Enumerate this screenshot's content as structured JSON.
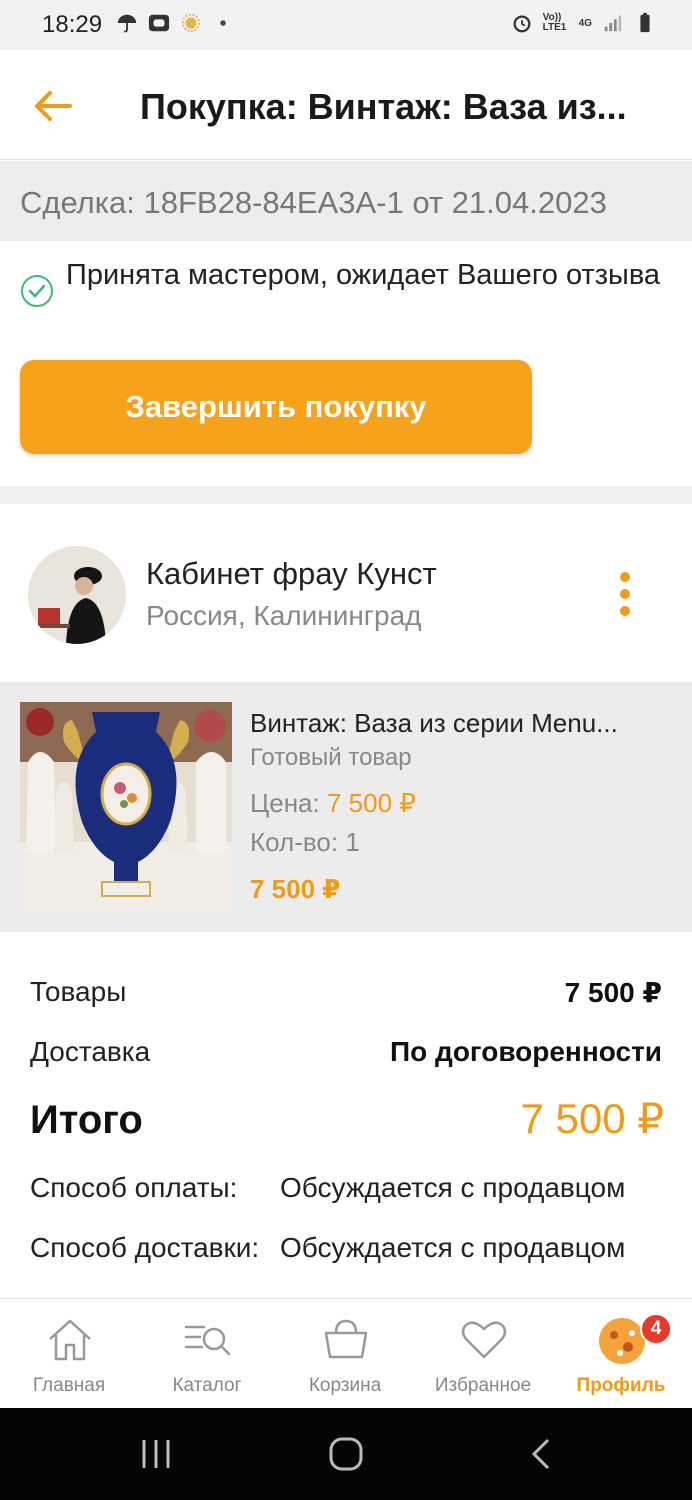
{
  "status_bar": {
    "time": "18:29",
    "network": "Vo)) LTE1",
    "signal": "4G"
  },
  "header": {
    "title": "Покупка: Винтаж: Ваза из..."
  },
  "deal": {
    "text": "Сделка: 18FB28-84EA3A-1 от 21.04.2023"
  },
  "status": {
    "message": "Принята мастером, ожидает Вашего отзыва"
  },
  "actions": {
    "complete_label": "Завершить покупку"
  },
  "seller": {
    "name": "Кабинет фрау Кунст",
    "location": "Россия, Калининград"
  },
  "product": {
    "title": "Винтаж: Ваза из серии Menu...",
    "type": "Готовый товар",
    "price_label": "Цена:",
    "price": "7 500 ₽",
    "qty_label": "Кол-во:",
    "qty": "1",
    "total": "7 500 ₽"
  },
  "summary": {
    "goods_label": "Товары",
    "goods_value": "7 500 ₽",
    "delivery_label": "Доставка",
    "delivery_value": "По договоренности",
    "total_label": "Итого",
    "total_value": "7 500 ₽",
    "payment_label": "Способ оплаты:",
    "payment_value": "Обсуждается с продавцом",
    "delivery_method_label": "Способ доставки:",
    "delivery_method_value": "Обсуждается с продавцом"
  },
  "tabs": [
    {
      "label": "Главная",
      "icon": "home-icon"
    },
    {
      "label": "Каталог",
      "icon": "catalog-search-icon"
    },
    {
      "label": "Корзина",
      "icon": "basket-icon"
    },
    {
      "label": "Избранное",
      "icon": "heart-icon"
    },
    {
      "label": "Профиль",
      "icon": "profile-avatar-icon",
      "active": true,
      "badge": "4"
    }
  ],
  "colors": {
    "accent": "#f7a21b",
    "accent_text": "#f19a12",
    "success": "#3cb878",
    "badge": "#e8392a"
  }
}
